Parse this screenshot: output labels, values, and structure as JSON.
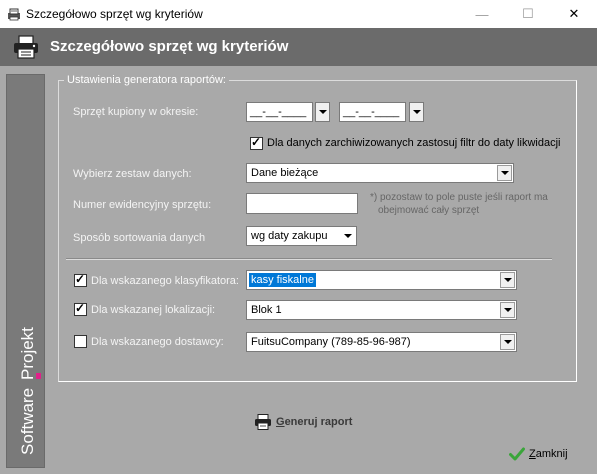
{
  "window": {
    "title": "Szczegółowo sprzęt wg kryteriów",
    "minimize_glyph": "—",
    "maximize_glyph": "☐",
    "close_glyph": "✕"
  },
  "header": {
    "title": "Szczegółowo sprzęt wg kryteriów",
    "icon": "printer-icon"
  },
  "sidebar": {
    "brand_part1": "Software",
    "brand_part2": "Projekt",
    "brand_highlight_color": "#e0218a"
  },
  "group": {
    "legend": "Ustawienia generatora raportów:"
  },
  "form": {
    "period_label": "Sprzęt kupiony w okresie:",
    "date_from": "__-__-____",
    "date_to": "__-__-____",
    "archived_checkbox_label": "Dla danych zarchiwizowanych zastosuj filtr do daty likwidacji",
    "archived_checked": true,
    "dataset_label": "Wybierz zestaw danych:",
    "dataset_value": "Dane bieżące",
    "inventory_label": "Numer ewidencyjny sprzętu:",
    "inventory_value": "",
    "inventory_note_line1": "*) pozostaw to pole puste jeśli raport ma",
    "inventory_note_line2": "obejmować cały sprzęt",
    "sort_label": "Sposób sortowania danych",
    "sort_value": "wg daty zakupu",
    "classifier_label": "Dla wskazanego klasyfikatora:",
    "classifier_checked": true,
    "classifier_value": "kasy fiskalne",
    "location_label": "Dla wskazanej lokalizacji:",
    "location_checked": true,
    "location_value": "Blok 1",
    "supplier_label": "Dla wskazanego dostawcy:",
    "supplier_checked": false,
    "supplier_value": "FuitsuCompany (789-85-96-987)"
  },
  "actions": {
    "generate_underlined": "G",
    "generate_rest": "eneruj raport",
    "close_underlined": "Z",
    "close_rest": "amknij"
  },
  "colors": {
    "header_bg": "#6b6b6b",
    "panel_bg": "#a9a9a9",
    "selection": "#0078d7",
    "close_check": "#3aa53a"
  }
}
